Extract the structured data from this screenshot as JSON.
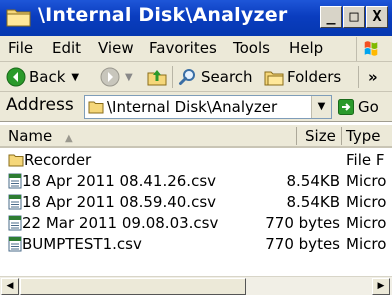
{
  "window": {
    "title": "\\Internal Disk\\Analyzer",
    "controls": {
      "minimize": "_",
      "maximize": "□",
      "close": "X"
    }
  },
  "menubar": {
    "items": [
      "File",
      "Edit",
      "View",
      "Favorites",
      "Tools",
      "Help"
    ]
  },
  "toolbar": {
    "back_label": "Back",
    "search_label": "Search",
    "folders_label": "Folders",
    "overflow": "»"
  },
  "address": {
    "label": "Address",
    "value": "\\Internal Disk\\Analyzer",
    "go_label": "Go"
  },
  "list": {
    "columns": [
      "Name",
      "Size",
      "Type"
    ],
    "rows": [
      {
        "name": "Recorder",
        "size": "",
        "type": "File F",
        "kind": "folder"
      },
      {
        "name": "18 Apr 2011 08.41.26.csv",
        "size": "8.54KB",
        "type": "Micro",
        "kind": "file"
      },
      {
        "name": "18 Apr 2011 08.59.40.csv",
        "size": "8.54KB",
        "type": "Micro",
        "kind": "file"
      },
      {
        "name": "22 Mar 2011 09.08.03.csv",
        "size": "770 bytes",
        "type": "Micro",
        "kind": "file"
      },
      {
        "name": "BUMPTEST1.csv",
        "size": "770 bytes",
        "type": "Micro",
        "kind": "file"
      }
    ]
  },
  "colors": {
    "titlebar": "#0a3dbf",
    "chrome": "#ece9d8",
    "window_bg": "#ffffff"
  },
  "icons": [
    "folder-icon",
    "windows-logo-icon",
    "back-arrow-icon",
    "forward-arrow-icon",
    "up-folder-icon",
    "search-icon",
    "folders-icon",
    "go-arrow-icon",
    "csv-file-icon"
  ]
}
